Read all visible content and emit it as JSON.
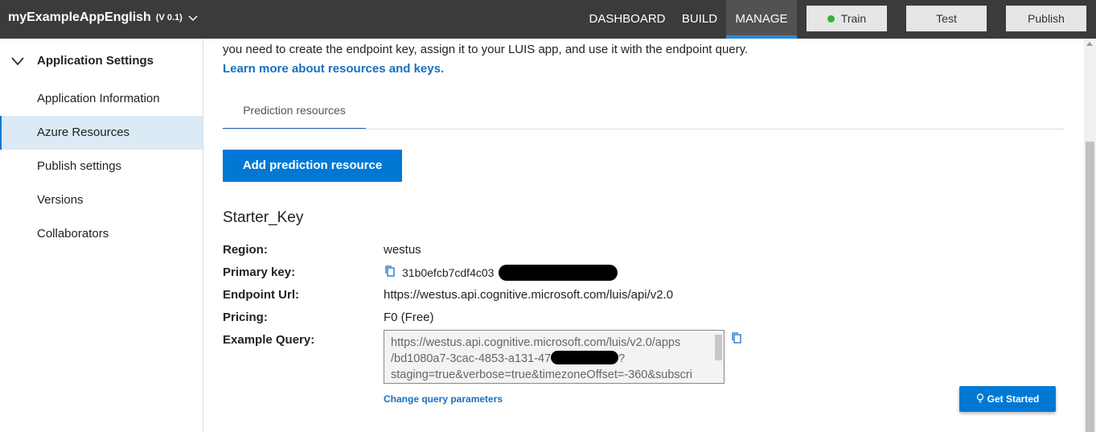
{
  "header": {
    "app_name": "myExampleAppEnglish",
    "app_version": "(V 0.1)",
    "nav": [
      {
        "label": "DASHBOARD"
      },
      {
        "label": "BUILD"
      },
      {
        "label": "MANAGE",
        "active": true
      }
    ],
    "buttons": {
      "train": "Train",
      "test": "Test",
      "publish": "Publish"
    },
    "train_status_color": "#34b233"
  },
  "sidebar": {
    "section_title": "Application Settings",
    "items": [
      {
        "label": "Application Information"
      },
      {
        "label": "Azure Resources",
        "selected": true
      },
      {
        "label": "Publish settings"
      },
      {
        "label": "Versions"
      },
      {
        "label": "Collaborators"
      }
    ]
  },
  "main": {
    "intro_text": "you need to create the endpoint key, assign it to your LUIS app, and use it with the endpoint query.",
    "learn_more": "Learn more about resources and keys.",
    "tab_label": "Prediction resources",
    "add_button": "Add prediction resource",
    "key": {
      "title": "Starter_Key",
      "rows": {
        "region_label": "Region:",
        "region_value": "westus",
        "primary_key_label": "Primary key:",
        "primary_key_value": "31b0efcb7cdf4c03",
        "endpoint_label": "Endpoint Url:",
        "endpoint_value": "https://westus.api.cognitive.microsoft.com/luis/api/v2.0",
        "pricing_label": "Pricing:",
        "pricing_value": "F0 (Free)",
        "example_query_label": "Example Query:"
      },
      "example_query_lines": [
        "https://westus.api.cognitive.microsoft.com/luis/v2.0/apps",
        "/bd1080a7-3cac-4853-a131-47",
        "staging=true&verbose=true&timezoneOffset=-360&subscri"
      ],
      "example_query_line2_suffix": "?",
      "change_query": "Change query parameters"
    },
    "get_started": "Get Started"
  },
  "colors": {
    "topbar_bg": "#3b3b3b",
    "accent": "#0078d4",
    "link": "#1a6fc0",
    "selected_bg": "#dbeaf5"
  }
}
